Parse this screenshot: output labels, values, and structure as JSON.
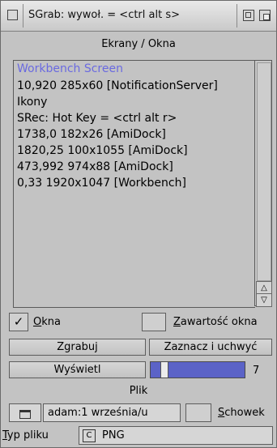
{
  "window": {
    "title": "SGrab: wywoł. = <ctrl alt s>"
  },
  "list": {
    "header": "Ekrany / Okna",
    "items": [
      "Workbench Screen",
      "10,920  285x60 [NotificationServer]",
      "Ikony",
      "SRec: Hot Key = <ctrl alt r>",
      "1738,0  182x26 [AmiDock]",
      "1820,25  100x1055 [AmiDock]",
      "473,992  974x88 [AmiDock]",
      "0,33  1920x1047 [Workbench]"
    ],
    "selected_index": 0
  },
  "options": {
    "windows_checked": true,
    "windows_label_u": "O",
    "windows_label_rest": "kna",
    "content_checked": false,
    "content_label_u": "Z",
    "content_label_rest": "awartość okna"
  },
  "buttons": {
    "grab": "Zgrabuj",
    "select_grab": "Zaznacz i uchwyć",
    "show": "Wyświetl"
  },
  "slider": {
    "value": "7",
    "level_fraction": 0.12
  },
  "file": {
    "header": "Plik",
    "path": "adam:1 września/u",
    "clipboard_label": "Schowek"
  },
  "filetype": {
    "label": "Typ pliku",
    "value": "PNG"
  },
  "colors": {
    "selection_text": "#6a6ae0",
    "slider_fill": "#5b63c7"
  },
  "icons": [
    "close-icon",
    "depth-icon",
    "iconify-icon",
    "drawer-icon",
    "cycle-icon",
    "arrow-up-icon",
    "arrow-down-icon"
  ]
}
